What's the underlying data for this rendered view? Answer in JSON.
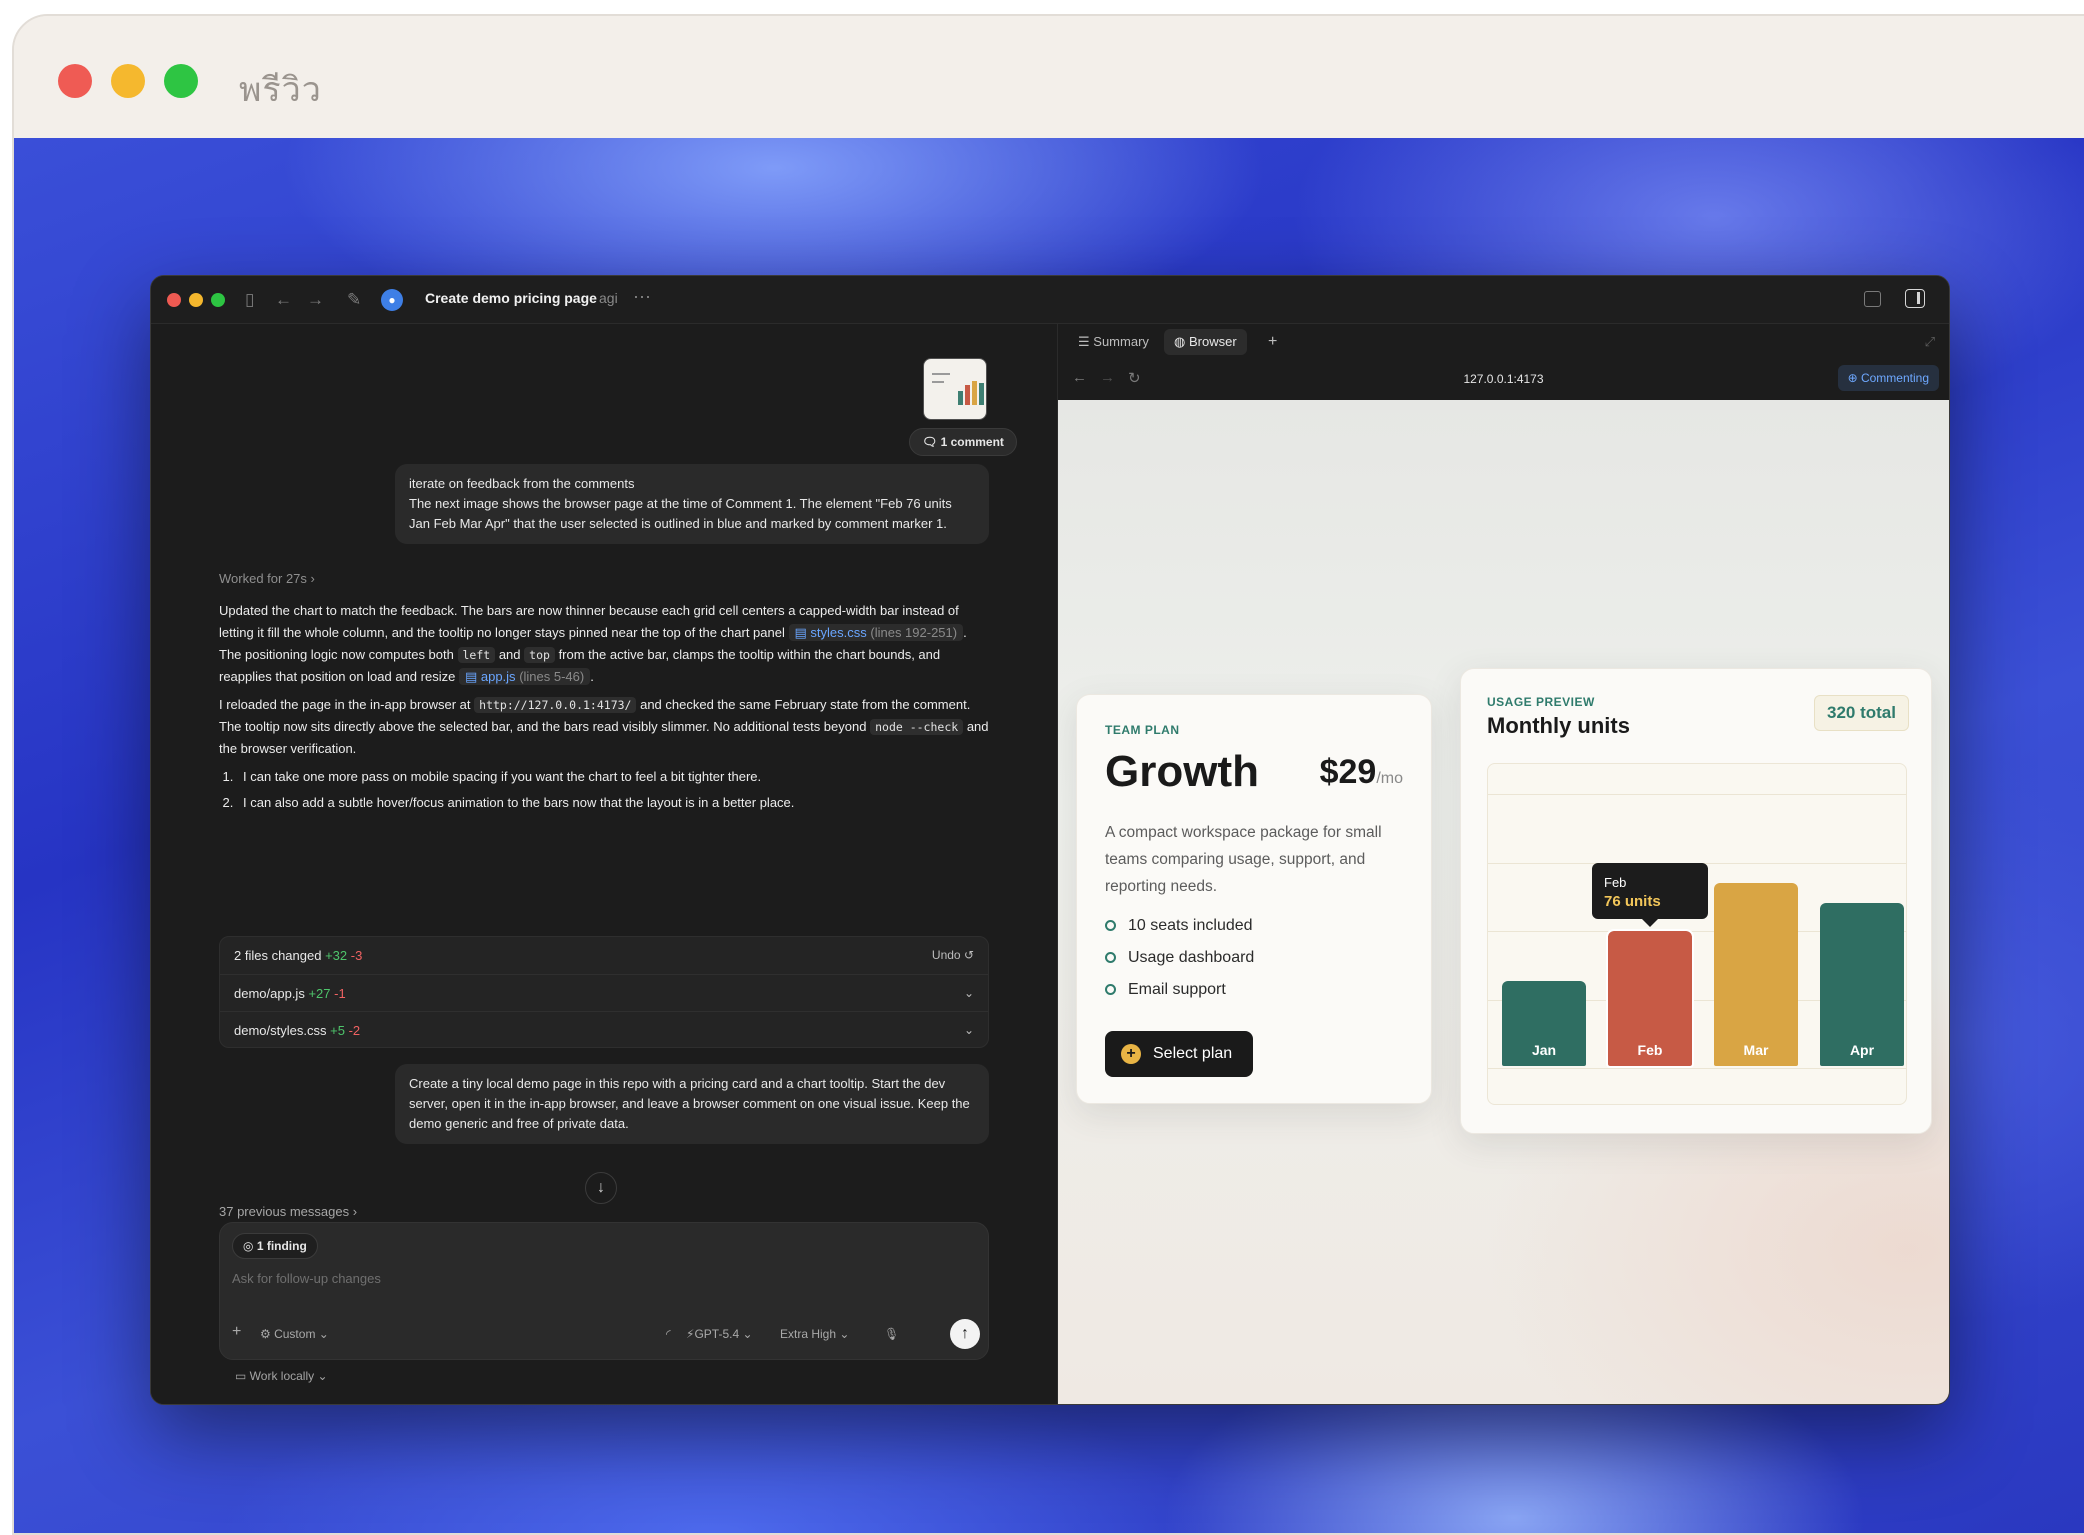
{
  "preview_window": {
    "title": "พรีวิว"
  },
  "app": {
    "title": "Create demo pricing page",
    "project": "agi",
    "more_icon": "ellipsis-icon"
  },
  "chat": {
    "comment_count": "1 comment",
    "user_message_1": {
      "line1": "iterate on feedback from the comments",
      "line2": "The next image shows the browser page at the time of Comment 1. The element \"Feb 76 units Jan Feb Mar Apr\" that the user selected is outlined in blue and marked by comment marker 1."
    },
    "worked_for": "Worked for 27s",
    "response": {
      "p1_a": "Updated the chart to match the feedback. The bars are now thinner because each grid cell centers a capped-width bar instead of letting it fill the whole column, and the tooltip no longer stays pinned near the top of the chart panel",
      "p1_file1": "styles.css",
      "p1_file1_lines": "(lines 192-251)",
      "p1_b": ". The positioning logic now computes both",
      "p1_code_left": "left",
      "p1_and": "and",
      "p1_code_top": "top",
      "p1_c": "from the active bar, clamps the tooltip within the chart bounds, and reapplies that position on load and resize",
      "p1_file2": "app.js",
      "p1_file2_lines": "(lines 5-46)",
      "p1_end": ".",
      "p2_a": "I reloaded the page in the in-app browser at",
      "p2_url": "http://127.0.0.1:4173/",
      "p2_b": "and checked the same February state from the comment. The tooltip now sits directly above the selected bar, and the bars read visibly slimmer. No additional tests beyond",
      "p2_code": "node --check",
      "p2_c": "and the browser verification.",
      "list": [
        "I can take one more pass on mobile spacing if you want the chart to feel a bit tighter there.",
        "I can also add a subtle hover/focus animation to the bars now that the layout is in a better place."
      ]
    },
    "changes": {
      "summary": "2 files changed",
      "summary_add": "+32",
      "summary_del": "-3",
      "undo_label": "Undo",
      "files": [
        {
          "name": "demo/app.js",
          "add": "+27",
          "del": "-1"
        },
        {
          "name": "demo/styles.css",
          "add": "+5",
          "del": "-2"
        }
      ]
    },
    "user_message_2": "Create a tiny local demo page in this repo with a pricing card and a chart tooltip. Start the dev server, open it in the in-app browser, and leave a browser comment on one visual issue. Keep the demo generic and free of private data.",
    "previous_messages": "37 previous messages",
    "composer": {
      "finding": "1 finding",
      "placeholder": "Ask for follow-up changes",
      "mode": "Custom",
      "model": "GPT-5.4",
      "effort": "Extra High"
    },
    "work_locally": "Work locally"
  },
  "browser": {
    "tabs": [
      "Summary",
      "Browser"
    ],
    "url": "127.0.0.1:4173",
    "commenting_label": "Commenting"
  },
  "pricing_card": {
    "eyebrow": "TEAM PLAN",
    "plan_name": "Growth",
    "price": "$29",
    "price_unit": "/mo",
    "description": "A compact workspace package for small teams comparing usage, support, and reporting needs.",
    "features": [
      "10 seats included",
      "Usage dashboard",
      "Email support"
    ],
    "button_label": "Select plan"
  },
  "usage_card": {
    "eyebrow": "USAGE PREVIEW",
    "title": "Monthly units",
    "total": "320 total",
    "tooltip_month": "Feb",
    "tooltip_value": "76 units"
  },
  "chart_data": {
    "type": "bar",
    "categories": [
      "Jan",
      "Feb",
      "Mar",
      "Apr"
    ],
    "values": [
      56,
      89,
      120,
      107
    ],
    "selected": "Feb",
    "colors": [
      "#2f6e62",
      "#c75a45",
      "#d9a544",
      "#2f6e62"
    ],
    "ylim": [
      0,
      180
    ],
    "grid": true,
    "legend": "none"
  }
}
